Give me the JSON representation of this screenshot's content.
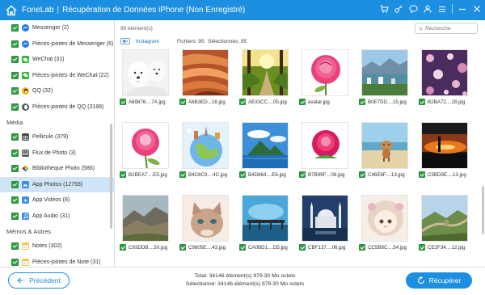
{
  "app": {
    "brand": "FoneLab",
    "separator": "|",
    "title": "Récupération de Données iPhone (Non Enregistré)"
  },
  "titlebar_icons": [
    "home-icon",
    "cart-icon",
    "key-icon",
    "chat-icon",
    "user-icon",
    "menu-icon",
    "minimize-icon",
    "close-icon"
  ],
  "sidebar": {
    "top_items": [
      {
        "label": "Messenger (2)",
        "icon": "messenger-icon",
        "color": "#1877f2"
      },
      {
        "label": "Pièces-jointes de Messenger (6)",
        "icon": "messenger-icon",
        "color": "#1877f2"
      },
      {
        "label": "WeChat (31)",
        "icon": "wechat-icon",
        "color": "#2eb82e"
      },
      {
        "label": "Pièces-jointes de WeChat (22)",
        "icon": "wechat-icon",
        "color": "#2eb82e"
      },
      {
        "label": "QQ (32)",
        "icon": "qq-icon",
        "color": "#ffb400"
      },
      {
        "label": "Pièces-jointes de QQ (3188)",
        "icon": "qq-icon",
        "color": "#555555"
      }
    ],
    "media_heading": "Média",
    "media_items": [
      {
        "label": "Pellicule (379)",
        "icon": "camera-icon",
        "color": "#444444"
      },
      {
        "label": "Flux de Photo (3)",
        "icon": "photo-stream-icon",
        "color": "#555555"
      },
      {
        "label": "Bibliothèque Photo (586)",
        "icon": "photo-library-icon",
        "color": "#666666"
      },
      {
        "label": "App Photos (12793)",
        "icon": "app-photos-icon",
        "color": "#3d8ee8",
        "selected": true
      },
      {
        "label": "App Vidéos (8)",
        "icon": "app-videos-icon",
        "color": "#3d8ee8"
      },
      {
        "label": "App Audio (31)",
        "icon": "app-audio-icon",
        "color": "#3d8ee8"
      }
    ],
    "memo_heading": "Mémos & Autres",
    "memo_items": [
      {
        "label": "Notes (302)",
        "icon": "notes-icon",
        "color": "#f5c542"
      },
      {
        "label": "Pièces-jointes de Note (31)",
        "icon": "notes-icon",
        "color": "#f5c542"
      }
    ]
  },
  "toolbar": {
    "count_label": "95 élément(s)",
    "folder_name": "Instagram",
    "files_label": "Fichiers: 95",
    "selected_label": "Sélectionnés: 95",
    "search_placeholder": "Recherche"
  },
  "photos": [
    {
      "name": "A69876....7A.jpg",
      "thumb": "samoyed-dogs"
    },
    {
      "name": "A8B3ED...18.jpg",
      "thumb": "canyon-rock"
    },
    {
      "name": "AE33CC....05.jpg",
      "thumb": "forest-path"
    },
    {
      "name": "avatar.jpg",
      "thumb": "pink-rose"
    },
    {
      "name": "B0E7DD....15.jpg",
      "thumb": "coastal-town"
    },
    {
      "name": "B2BA72....28.jpg",
      "thumb": "purple-floral"
    },
    {
      "name": "B2BEA7....E5.jpg",
      "thumb": "pink-rose"
    },
    {
      "name": "B4C8C9....4C.jpg",
      "thumb": "globe-landmarks"
    },
    {
      "name": "B4D864....E6.jpg",
      "thumb": "island-sky"
    },
    {
      "name": "B7B99F....06.jpg",
      "thumb": "red-rose"
    },
    {
      "name": "C46E6F....13.jpg",
      "thumb": "dog-beach"
    },
    {
      "name": "C5BD9E....13.jpg",
      "thumb": "sunset-silhouette"
    },
    {
      "name": "C93DDB....50.jpg",
      "thumb": "rock-hills"
    },
    {
      "name": "C9805E....43.jpg",
      "thumb": "kitten"
    },
    {
      "name": "CA0BD1....D5.jpg",
      "thumb": "pier-sky"
    },
    {
      "name": "CBF137....06.jpg",
      "thumb": "mosque"
    },
    {
      "name": "CC5B8C....54.jpg",
      "thumb": "anime-girl"
    },
    {
      "name": "CE2F34....12.jpg",
      "thumb": "great-wall"
    }
  ],
  "footer": {
    "prev_label": "Précédent",
    "total_line": "Total: 34146 élément(s) 979.30 Mo octets",
    "selected_line": "Sélectionné: 34146 élément(s) 979.30 Mo octets",
    "recover_label": "Récupérer"
  },
  "colors": {
    "accent": "#1d8fe0",
    "check": "#2ea043",
    "selected_row": "#cfe5f7"
  }
}
